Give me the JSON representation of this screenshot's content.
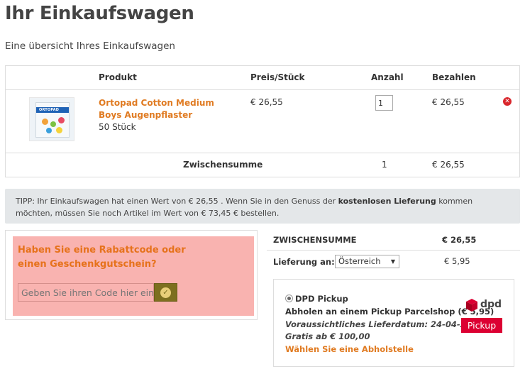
{
  "page": {
    "title": "Ihr Einkaufswagen",
    "subtitle": "Eine übersicht Ihres Einkaufswagen"
  },
  "cart_table": {
    "headers": {
      "product": "Produkt",
      "price": "Preis/Stück",
      "quantity": "Anzahl",
      "total": "Bezahlen"
    },
    "items": [
      {
        "name": "Ortopad Cotton Medium Boys Augenpflaster",
        "variant": "50 Stück",
        "price": "€ 26,55",
        "quantity": "1",
        "total": "€ 26,55",
        "image_brand": "ORTOPAD"
      }
    ],
    "subtotal": {
      "label": "Zwischensumme",
      "quantity": "1",
      "amount": "€ 26,55"
    }
  },
  "tip": {
    "text_1": "TIPP: Ihr Einkaufswagen hat einen Wert von € 26,55 . Wenn Sie in den Genuss der ",
    "text_bold": "kostenlosen Lieferung",
    "text_2": " kommen möchten, müssen Sie noch Artikel im Wert von € 73,45 €  bestellen."
  },
  "coupon": {
    "title": "Haben Sie eine Rabattcode oder einen Geschenkgutschein?",
    "placeholder": "Geben Sie ihren Code hier ein",
    "submit_icon": "check-icon"
  },
  "totals": {
    "subtotal_label": "ZWISCHENSUMME",
    "subtotal_value": "€ 26,55",
    "delivery_label": "Lieferung an:",
    "delivery_country": "Österreich",
    "delivery_cost": "€ 5,95"
  },
  "shipping_option": {
    "name": "DPD Pickup",
    "description": "Abholen an einem Pickup Parcelshop (€ 5,95)",
    "delivery_date": "Voraussichtliches Lieferdatum: 24-04-2017",
    "free_from": "Gratis ab € 100,00",
    "select_link": "Wählen Sie eine Abholstelle",
    "logo_text": "dpd",
    "badge_text": "Pickup"
  },
  "colors": {
    "accent_orange": "#e07b22",
    "coupon_bg": "#f9b3b0",
    "remove_red": "#d9262c",
    "dpd_red": "#dc0032"
  }
}
